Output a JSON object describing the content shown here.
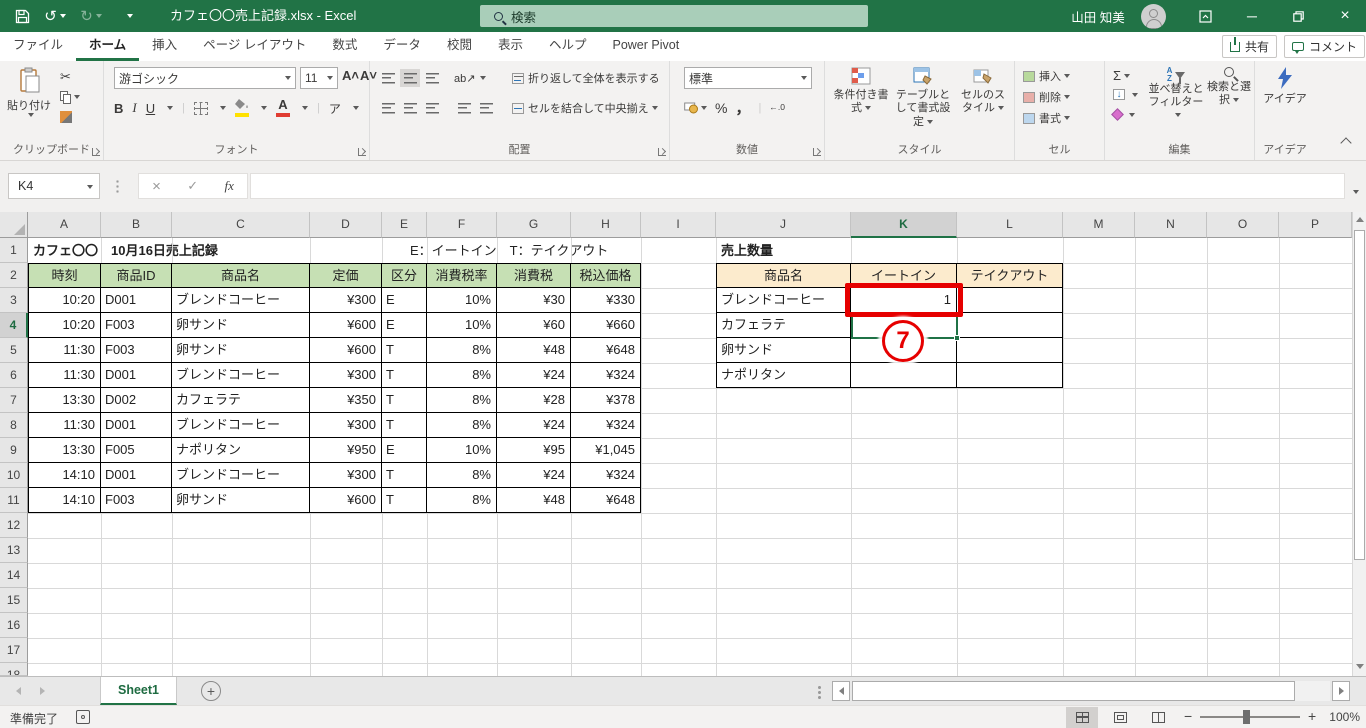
{
  "colors": {
    "accent": "#217346",
    "annotation_red": "#e60000",
    "sales_header_green": "#c6e0b4",
    "summary_header_tan": "#fcebcd"
  },
  "titlebar": {
    "title": "カフェ〇〇売上記録.xlsx  -  Excel",
    "search_placeholder": "検索",
    "user_name": "山田 知美"
  },
  "icons": {
    "undo": "↺",
    "redo": "↻",
    "scissors": "✂",
    "bold": "B",
    "italic": "I",
    "underline": "U",
    "phonetic": "ア",
    "sigma": "Σ",
    "percent": "%",
    "comma": "，",
    "fill_down": "↓",
    "orientation": "ab↗",
    "close": "×",
    "minimize": "─",
    "check": "✓",
    "cancel": "×",
    "fx": "fx",
    "plus": "+",
    "zoom_out": "−",
    "zoom_in": "+",
    "font_grow": "A˄",
    "font_shrink": "A˅",
    "inc_dec": "←.0",
    ".dec_inc": ".00→"
  },
  "menu": {
    "tabs": [
      "ファイル",
      "ホーム",
      "挿入",
      "ページ レイアウト",
      "数式",
      "データ",
      "校閲",
      "表示",
      "ヘルプ",
      "Power Pivot"
    ],
    "active_tab": "ホーム",
    "share": "共有",
    "comment": "コメント"
  },
  "ribbon": {
    "clipboard": {
      "label": "クリップボード",
      "paste": "貼り付け"
    },
    "font": {
      "label": "フォント",
      "name": "游ゴシック",
      "size": "11"
    },
    "alignment": {
      "label": "配置",
      "wrap": "折り返して全体を表示する",
      "merge": "セルを結合して中央揃え"
    },
    "number": {
      "label": "数値",
      "format": "標準"
    },
    "styles": {
      "label": "スタイル",
      "conditional": "条件付き書式",
      "as_table": "テーブルとして書式設定",
      "cell_styles": "セルのスタイル"
    },
    "cells": {
      "label": "セル",
      "insert": "挿入",
      "delete": "削除",
      "format": "書式"
    },
    "editing": {
      "label": "編集",
      "sort_filter": "並べ替えとフィルター",
      "find_select": "検索と選択"
    },
    "ideas": {
      "label": "アイデア",
      "button": "アイデア"
    }
  },
  "formula_bar": {
    "name_box": "K4",
    "value": ""
  },
  "grid": {
    "col_letters": [
      "A",
      "B",
      "C",
      "D",
      "E",
      "F",
      "G",
      "H",
      "I",
      "J",
      "K",
      "L",
      "M",
      "N",
      "O",
      "P"
    ],
    "row_numbers": [
      "1",
      "2",
      "3",
      "4",
      "5",
      "6",
      "7",
      "8",
      "9",
      "10",
      "11",
      "12",
      "13",
      "14",
      "15",
      "16",
      "17",
      "18"
    ],
    "selected_cell": "K4",
    "selected_col": "K",
    "selected_row": "4"
  },
  "sheet": {
    "title": "カフェ〇〇　10月16日売上記録",
    "legend": "E：イートイン　T：テイクアウト",
    "sales_table": {
      "headers": [
        "時刻",
        "商品ID",
        "商品名",
        "定価",
        "区分",
        "消費税率",
        "消費税",
        "税込価格"
      ],
      "rows": [
        [
          "10:20",
          "D001",
          "ブレンドコーヒー",
          "¥300",
          "E",
          "10%",
          "¥30",
          "¥330"
        ],
        [
          "10:20",
          "F003",
          "卵サンド",
          "¥600",
          "E",
          "10%",
          "¥60",
          "¥660"
        ],
        [
          "11:30",
          "F003",
          "卵サンド",
          "¥600",
          "T",
          "8%",
          "¥48",
          "¥648"
        ],
        [
          "11:30",
          "D001",
          "ブレンドコーヒー",
          "¥300",
          "T",
          "8%",
          "¥24",
          "¥324"
        ],
        [
          "13:30",
          "D002",
          "カフェラテ",
          "¥350",
          "T",
          "8%",
          "¥28",
          "¥378"
        ],
        [
          "11:30",
          "D001",
          "ブレンドコーヒー",
          "¥300",
          "T",
          "8%",
          "¥24",
          "¥324"
        ],
        [
          "13:30",
          "F005",
          "ナポリタン",
          "¥950",
          "E",
          "10%",
          "¥95",
          "¥1,045"
        ],
        [
          "14:10",
          "D001",
          "ブレンドコーヒー",
          "¥300",
          "T",
          "8%",
          "¥24",
          "¥324"
        ],
        [
          "14:10",
          "F003",
          "卵サンド",
          "¥600",
          "T",
          "8%",
          "¥48",
          "¥648"
        ]
      ]
    },
    "summary_table": {
      "title": "売上数量",
      "headers": [
        "商品名",
        "イートイン",
        "テイクアウト"
      ],
      "rows": [
        [
          "ブレンドコーヒー",
          "1",
          ""
        ],
        [
          "カフェラテ",
          "",
          ""
        ],
        [
          "卵サンド",
          "",
          ""
        ],
        [
          "ナポリタン",
          "",
          ""
        ]
      ]
    },
    "annotation_step": "7"
  },
  "sheet_tabs": {
    "active": "Sheet1",
    "add": "+"
  },
  "status_bar": {
    "ready": "準備完了",
    "zoom_level": "100%"
  }
}
